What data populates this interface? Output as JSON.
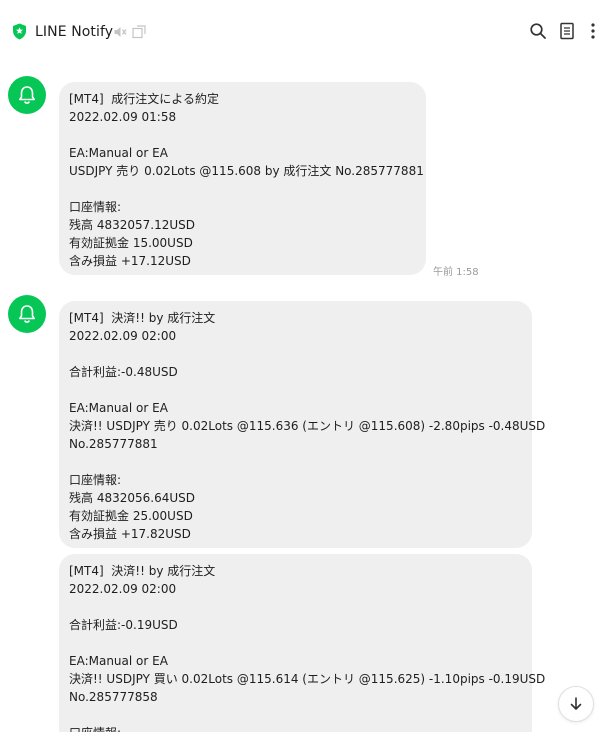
{
  "header": {
    "title": "LINE Notify",
    "icons": [
      "shield-icon",
      "mute-icon",
      "popout-icon",
      "search-icon",
      "notes-icon",
      "more-icon"
    ]
  },
  "colors": {
    "accent": "#06c755",
    "bubble": "#efefef",
    "time": "#9a9a9a"
  },
  "messages": [
    {
      "lines": [
        "[MT4]  成行注文による約定",
        "2022.02.09 01:58",
        "",
        "EA:Manual or EA",
        "USDJPY 売り 0.02Lots @115.608 by 成行注文 No.285777881",
        "",
        "口座情報:",
        "残高 4832057.12USD",
        "有効証拠金 15.00USD",
        "含み損益 +17.12USD"
      ],
      "time": "午前 1:58"
    },
    {
      "lines": [
        "[MT4]  決済!! by 成行注文",
        "2022.02.09 02:00",
        "",
        "合計利益:-0.48USD",
        "",
        "EA:Manual or EA",
        "決済!! USDJPY 売り 0.02Lots @115.636 (エントリ @115.608) -2.80pips -0.48USD",
        "No.285777881",
        "",
        "口座情報:",
        "残高 4832056.64USD",
        "有効証拠金 25.00USD",
        "含み損益 +17.82USD"
      ]
    },
    {
      "lines": [
        "[MT4]  決済!! by 成行注文",
        "2022.02.09 02:00",
        "",
        "合計利益:-0.19USD",
        "",
        "EA:Manual or EA",
        "決済!! USDJPY 買い 0.02Lots @115.614 (エントリ @115.625) -1.10pips -0.19USD",
        "No.285777858",
        "",
        "口座情報:"
      ]
    }
  ]
}
